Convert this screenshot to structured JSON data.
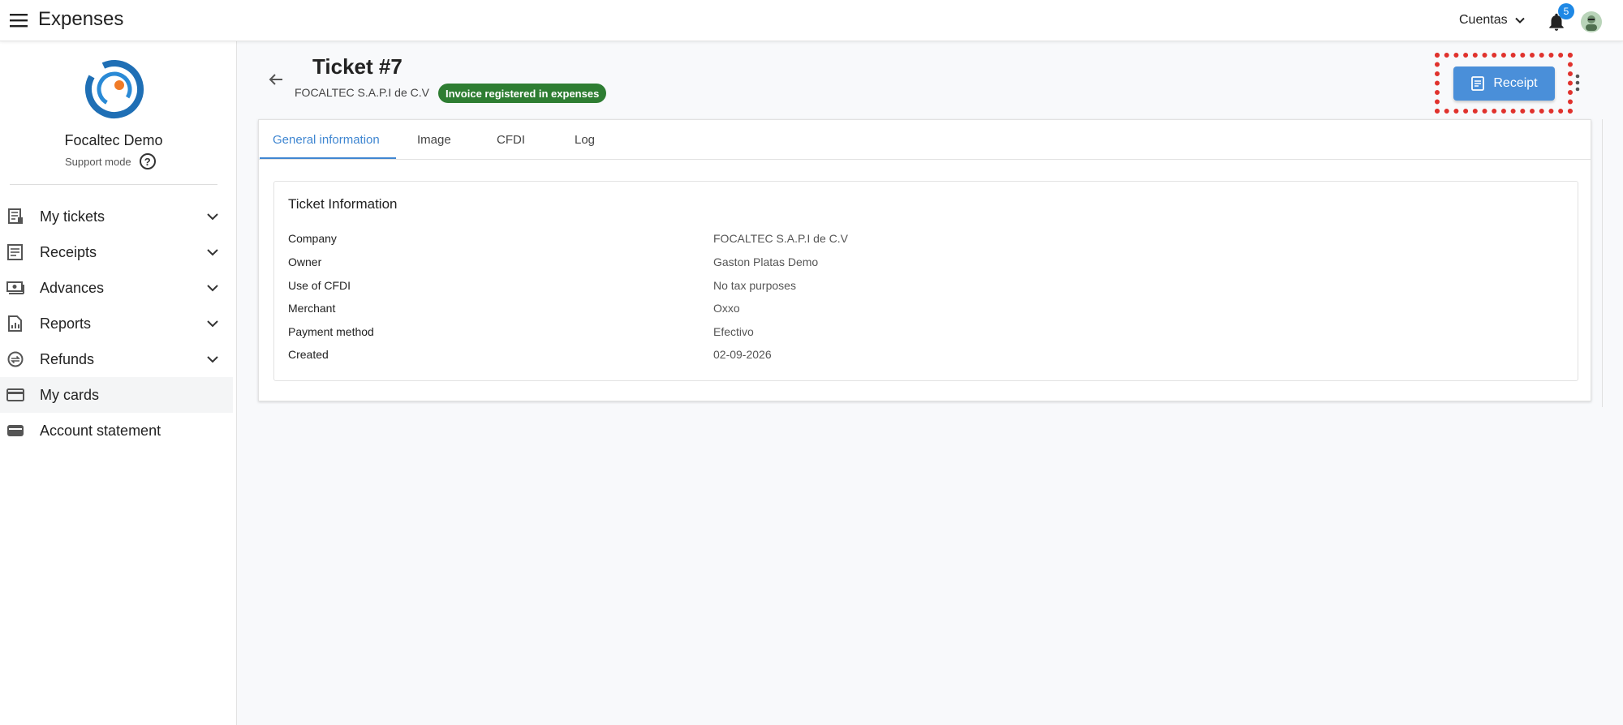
{
  "header": {
    "app_title": "Expenses",
    "accounts_label": "Cuentas",
    "notification_count": "5"
  },
  "sidebar": {
    "org_name": "Focaltec Demo",
    "support_mode": "Support mode",
    "help_glyph": "?",
    "items": [
      {
        "label": "My tickets",
        "icon": "receipt-long-icon",
        "expandable": true
      },
      {
        "label": "Receipts",
        "icon": "document-icon",
        "expandable": true
      },
      {
        "label": "Advances",
        "icon": "cash-icon",
        "expandable": true
      },
      {
        "label": "Reports",
        "icon": "report-icon",
        "expandable": true
      },
      {
        "label": "Refunds",
        "icon": "refund-icon",
        "expandable": true
      },
      {
        "label": "My cards",
        "icon": "credit-card-icon",
        "expandable": false,
        "active": true
      },
      {
        "label": "Account statement",
        "icon": "wallet-icon",
        "expandable": false
      }
    ]
  },
  "ticket": {
    "title": "Ticket #7",
    "company": "FOCALTEC S.A.P.I de C.V",
    "status": "Invoice registered in expenses",
    "receipt_button": "Receipt"
  },
  "tabs": [
    "General information",
    "Image",
    "CFDI",
    "Log"
  ],
  "info": {
    "title": "Ticket Information",
    "rows": [
      {
        "label": "Company",
        "value": "FOCALTEC S.A.P.I de C.V"
      },
      {
        "label": "Owner",
        "value": "Gaston Platas Demo"
      },
      {
        "label": "Use of CFDI",
        "value": "No tax purposes"
      },
      {
        "label": "Merchant",
        "value": "Oxxo"
      },
      {
        "label": "Payment method",
        "value": "Efectivo"
      },
      {
        "label": "Created",
        "value": "02-09-2026"
      }
    ]
  },
  "colors": {
    "accent": "#3f86d1",
    "status_green": "#2e7d32",
    "button_blue": "#4a8fd9",
    "highlight_red": "#e0322d"
  }
}
